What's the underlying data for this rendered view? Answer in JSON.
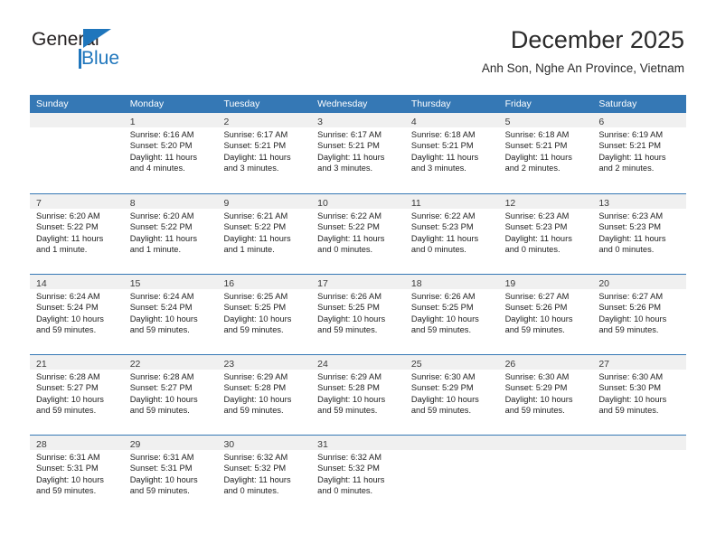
{
  "brand": {
    "name_part1": "General",
    "name_part2": "Blue",
    "accent_color": "#1f76bc"
  },
  "header": {
    "title": "December 2025",
    "subtitle": "Anh Son, Nghe An Province, Vietnam"
  },
  "theme": {
    "header_band_color": "#3578b5",
    "daynum_band_color": "#f0f0f0",
    "text_color": "#222222"
  },
  "calendar": {
    "day_names": [
      "Sunday",
      "Monday",
      "Tuesday",
      "Wednesday",
      "Thursday",
      "Friday",
      "Saturday"
    ],
    "weeks": [
      [
        {
          "day": "",
          "lines": []
        },
        {
          "day": "1",
          "lines": [
            "Sunrise: 6:16 AM",
            "Sunset: 5:20 PM",
            "Daylight: 11 hours",
            "and 4 minutes."
          ]
        },
        {
          "day": "2",
          "lines": [
            "Sunrise: 6:17 AM",
            "Sunset: 5:21 PM",
            "Daylight: 11 hours",
            "and 3 minutes."
          ]
        },
        {
          "day": "3",
          "lines": [
            "Sunrise: 6:17 AM",
            "Sunset: 5:21 PM",
            "Daylight: 11 hours",
            "and 3 minutes."
          ]
        },
        {
          "day": "4",
          "lines": [
            "Sunrise: 6:18 AM",
            "Sunset: 5:21 PM",
            "Daylight: 11 hours",
            "and 3 minutes."
          ]
        },
        {
          "day": "5",
          "lines": [
            "Sunrise: 6:18 AM",
            "Sunset: 5:21 PM",
            "Daylight: 11 hours",
            "and 2 minutes."
          ]
        },
        {
          "day": "6",
          "lines": [
            "Sunrise: 6:19 AM",
            "Sunset: 5:21 PM",
            "Daylight: 11 hours",
            "and 2 minutes."
          ]
        }
      ],
      [
        {
          "day": "7",
          "lines": [
            "Sunrise: 6:20 AM",
            "Sunset: 5:22 PM",
            "Daylight: 11 hours",
            "and 1 minute."
          ]
        },
        {
          "day": "8",
          "lines": [
            "Sunrise: 6:20 AM",
            "Sunset: 5:22 PM",
            "Daylight: 11 hours",
            "and 1 minute."
          ]
        },
        {
          "day": "9",
          "lines": [
            "Sunrise: 6:21 AM",
            "Sunset: 5:22 PM",
            "Daylight: 11 hours",
            "and 1 minute."
          ]
        },
        {
          "day": "10",
          "lines": [
            "Sunrise: 6:22 AM",
            "Sunset: 5:22 PM",
            "Daylight: 11 hours",
            "and 0 minutes."
          ]
        },
        {
          "day": "11",
          "lines": [
            "Sunrise: 6:22 AM",
            "Sunset: 5:23 PM",
            "Daylight: 11 hours",
            "and 0 minutes."
          ]
        },
        {
          "day": "12",
          "lines": [
            "Sunrise: 6:23 AM",
            "Sunset: 5:23 PM",
            "Daylight: 11 hours",
            "and 0 minutes."
          ]
        },
        {
          "day": "13",
          "lines": [
            "Sunrise: 6:23 AM",
            "Sunset: 5:23 PM",
            "Daylight: 11 hours",
            "and 0 minutes."
          ]
        }
      ],
      [
        {
          "day": "14",
          "lines": [
            "Sunrise: 6:24 AM",
            "Sunset: 5:24 PM",
            "Daylight: 10 hours",
            "and 59 minutes."
          ]
        },
        {
          "day": "15",
          "lines": [
            "Sunrise: 6:24 AM",
            "Sunset: 5:24 PM",
            "Daylight: 10 hours",
            "and 59 minutes."
          ]
        },
        {
          "day": "16",
          "lines": [
            "Sunrise: 6:25 AM",
            "Sunset: 5:25 PM",
            "Daylight: 10 hours",
            "and 59 minutes."
          ]
        },
        {
          "day": "17",
          "lines": [
            "Sunrise: 6:26 AM",
            "Sunset: 5:25 PM",
            "Daylight: 10 hours",
            "and 59 minutes."
          ]
        },
        {
          "day": "18",
          "lines": [
            "Sunrise: 6:26 AM",
            "Sunset: 5:25 PM",
            "Daylight: 10 hours",
            "and 59 minutes."
          ]
        },
        {
          "day": "19",
          "lines": [
            "Sunrise: 6:27 AM",
            "Sunset: 5:26 PM",
            "Daylight: 10 hours",
            "and 59 minutes."
          ]
        },
        {
          "day": "20",
          "lines": [
            "Sunrise: 6:27 AM",
            "Sunset: 5:26 PM",
            "Daylight: 10 hours",
            "and 59 minutes."
          ]
        }
      ],
      [
        {
          "day": "21",
          "lines": [
            "Sunrise: 6:28 AM",
            "Sunset: 5:27 PM",
            "Daylight: 10 hours",
            "and 59 minutes."
          ]
        },
        {
          "day": "22",
          "lines": [
            "Sunrise: 6:28 AM",
            "Sunset: 5:27 PM",
            "Daylight: 10 hours",
            "and 59 minutes."
          ]
        },
        {
          "day": "23",
          "lines": [
            "Sunrise: 6:29 AM",
            "Sunset: 5:28 PM",
            "Daylight: 10 hours",
            "and 59 minutes."
          ]
        },
        {
          "day": "24",
          "lines": [
            "Sunrise: 6:29 AM",
            "Sunset: 5:28 PM",
            "Daylight: 10 hours",
            "and 59 minutes."
          ]
        },
        {
          "day": "25",
          "lines": [
            "Sunrise: 6:30 AM",
            "Sunset: 5:29 PM",
            "Daylight: 10 hours",
            "and 59 minutes."
          ]
        },
        {
          "day": "26",
          "lines": [
            "Sunrise: 6:30 AM",
            "Sunset: 5:29 PM",
            "Daylight: 10 hours",
            "and 59 minutes."
          ]
        },
        {
          "day": "27",
          "lines": [
            "Sunrise: 6:30 AM",
            "Sunset: 5:30 PM",
            "Daylight: 10 hours",
            "and 59 minutes."
          ]
        }
      ],
      [
        {
          "day": "28",
          "lines": [
            "Sunrise: 6:31 AM",
            "Sunset: 5:31 PM",
            "Daylight: 10 hours",
            "and 59 minutes."
          ]
        },
        {
          "day": "29",
          "lines": [
            "Sunrise: 6:31 AM",
            "Sunset: 5:31 PM",
            "Daylight: 10 hours",
            "and 59 minutes."
          ]
        },
        {
          "day": "30",
          "lines": [
            "Sunrise: 6:32 AM",
            "Sunset: 5:32 PM",
            "Daylight: 11 hours",
            "and 0 minutes."
          ]
        },
        {
          "day": "31",
          "lines": [
            "Sunrise: 6:32 AM",
            "Sunset: 5:32 PM",
            "Daylight: 11 hours",
            "and 0 minutes."
          ]
        },
        {
          "day": "",
          "lines": []
        },
        {
          "day": "",
          "lines": []
        },
        {
          "day": "",
          "lines": []
        }
      ]
    ]
  }
}
